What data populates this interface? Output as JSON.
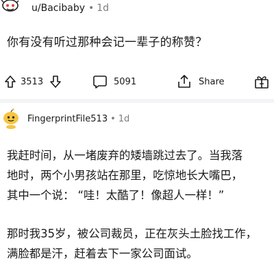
{
  "post": {
    "username": "u/Bacibaby",
    "separator": "•",
    "age": "1d",
    "title": "你有没有听过那种会记一辈子的称赞？",
    "actions": {
      "vote_count": "3513",
      "comment_count": "5091",
      "share_label": "Share"
    }
  },
  "comment": {
    "username": "FingerprintFile513",
    "separator": "•",
    "age": "1d",
    "paragraphs": [
      [
        "我赶时间，从一堵废弃的矮墙跳过去了。当我落",
        "地时，两个小男孩站在那里，吃惊地长大嘴巴，",
        "其中一个说：  “哇！太酷了！像超人一样！”"
      ],
      [
        "那时我35岁，被公司裁员，正在灰头土脸找工作，",
        "满脸都是汗，赶着去下一家公司面试。"
      ]
    ]
  },
  "colors": {
    "text": "#1a1a1b",
    "meta": "#7c7c7c",
    "divider": "#f3f4f5",
    "avatar_yellow": "#f5c542",
    "snoo_red": "#e0443a"
  },
  "icons": {
    "post_avatar": "snoo-avatar-icon",
    "upvote": "upvote-arrow-icon",
    "downvote": "downvote-arrow-icon",
    "comment": "comment-bubble-icon",
    "share": "share-icon",
    "award": "award-icon",
    "comment_avatar": "snoo-yellow-avatar-icon"
  }
}
